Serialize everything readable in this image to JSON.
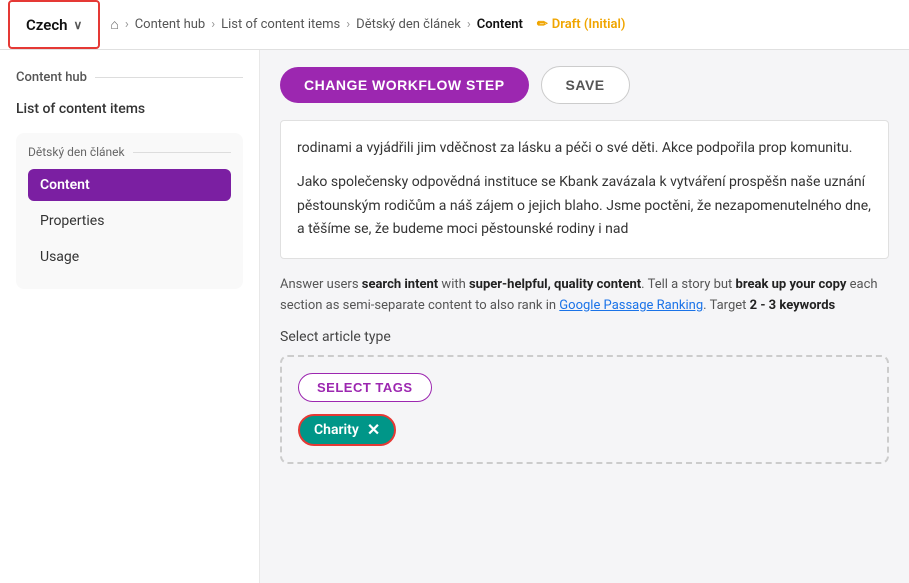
{
  "header": {
    "lang_label": "Czech",
    "chevron": "∨",
    "home_icon": "⌂",
    "breadcrumb": [
      {
        "label": "Content hub",
        "active": false
      },
      {
        "label": "List of content items",
        "active": false
      },
      {
        "label": "Dětský den článek",
        "active": false
      },
      {
        "label": "Content",
        "active": true
      }
    ],
    "draft_badge": "Draft (Initial)",
    "pencil_icon": "✏"
  },
  "sidebar": {
    "section_title": "Content hub",
    "list_item": "List of content items",
    "sub_title": "Dětský den článek",
    "nav_items": [
      {
        "label": "Content",
        "active": true
      },
      {
        "label": "Properties",
        "active": false
      },
      {
        "label": "Usage",
        "active": false
      }
    ]
  },
  "toolbar": {
    "change_workflow_label": "CHANGE WORKFLOW STEP",
    "save_label": "SAVE"
  },
  "article": {
    "paragraph1": "rodinami a vyjádřili jim vděčnost za lásku a péči o své děti. Akce podpořila prop komunitu.",
    "paragraph2": "Jako společensky odpovědná instituce se Kbank zavázala k vytváření prospěšn naše uznání pěstounským rodičům a náš zájem o jejich blaho. Jsme poctěni, že nezapomenutelného dne, a těšíme se, že budeme moci pěstounské rodiny i nad"
  },
  "seo_hint": {
    "text_parts": [
      "Answer users ",
      "search intent",
      " with ",
      "super-helpful, quality content",
      ". Tell a story but ",
      "break up your copy",
      " each section as semi-separate content to also rank in ",
      "Google Passage Ranking",
      ". Target ",
      "2 - 3 keywords"
    ],
    "link_text": "Google Passage Ranking",
    "link_url": "#"
  },
  "article_type": {
    "label": "Select article type",
    "select_tags_label": "SELECT TAGS",
    "tags": [
      {
        "label": "Charity",
        "removable": true
      }
    ]
  },
  "colors": {
    "purple": "#9c27b0",
    "teal": "#009688",
    "red_border": "#e53935",
    "draft_gold": "#f0a500"
  }
}
